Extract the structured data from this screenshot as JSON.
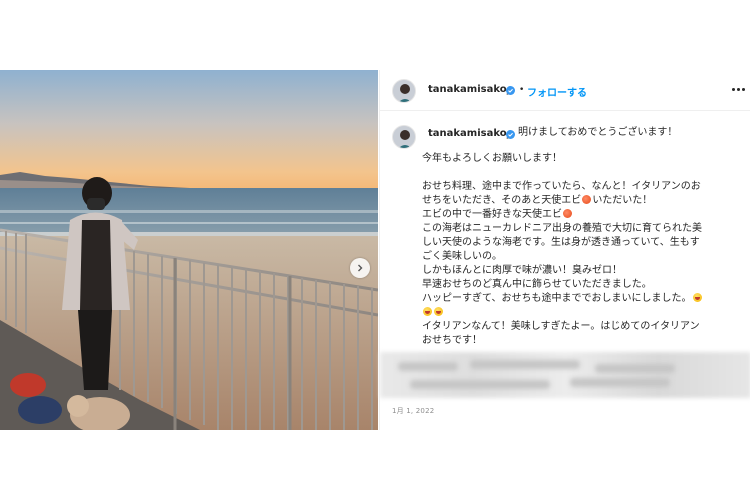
{
  "post": {
    "author": {
      "username": "tanakamisako_",
      "verified": true,
      "follow_label": "フォローする",
      "separator": "•"
    },
    "more_icon": "more-options-icon",
    "next_icon": "chevron-right-icon",
    "caption_lines": [
      "明けましておめでとうございます！",
      "",
      "今年もよろしくお願いします！",
      "",
      "おせち料理、途中まで作っていたら、なんと！イタリアンのお",
      "せちをいただき、そのあと天使エビ",
      "いただいた！",
      "エビの中で一番好きな天使エビ",
      "この海老はニューカレドニア出身の養殖で大切に育てられた美",
      "しい天使のような海老です。生は身が透き通っていて、生もす",
      "ごく美味しいの。",
      "しかもほんとに肉厚で味が濃い！臭みゼロ！",
      "早速おせちのど真ん中に飾らせていただきました。",
      "ハッピーすぎて、おせちも途中まででおしまいにしました。",
      "イタリアンなんて！美味しすぎたよー。はじめてのイタリアン",
      "おせちです！"
    ],
    "date": "1月 1, 2022"
  },
  "colors": {
    "accent": "#0095f6",
    "verified": "#3897f0",
    "text": "#262626",
    "muted": "#8e8e8e"
  }
}
